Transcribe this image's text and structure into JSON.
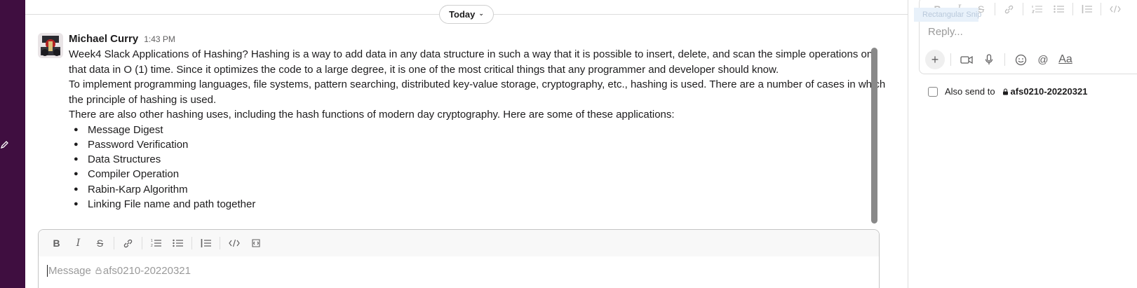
{
  "date_divider": {
    "label": "Today"
  },
  "message": {
    "sender": "Michael Curry",
    "time": "1:43 PM",
    "paragraphs": [
      "Week4 Slack Applications of Hashing? Hashing is a way to add data in any data structure in such a way that it is possible to insert, delete, and scan the simple operations on that data in O (1) time. Since it optimizes the code to a large degree, it is one of the most critical things that any programmer and developer should know.",
      "To implement programming languages, file systems, pattern searching, distributed key-value storage, cryptography, etc., hashing is used. There are a number of cases in which the principle of hashing is used.",
      "There are also other hashing uses, including the hash functions of modern day cryptography. Here are some of these applications:"
    ],
    "bullets": [
      "Message Digest",
      "Password Verification",
      "Data Structures",
      "Compiler Operation",
      "Rabin-Karp Algorithm",
      "Linking File name and path together"
    ]
  },
  "composer": {
    "placeholder_prefix": "Message",
    "channel": "afs0210-20220321",
    "toolbar_icons": [
      "bold-icon",
      "italic-icon",
      "strikethrough-icon",
      "link-icon",
      "ordered-list-icon",
      "bulleted-list-icon",
      "blockquote-icon",
      "code-icon",
      "code-block-icon"
    ]
  },
  "thread": {
    "snip_label": "Rectangular Snip",
    "reply_placeholder": "Reply...",
    "also_send_label": "Also send to",
    "also_send_channel": "afs0210-20220321",
    "action_icons": [
      "plus-icon",
      "video-icon",
      "microphone-icon",
      "emoji-icon",
      "mention-icon",
      "format-icon"
    ]
  },
  "colors": {
    "sidebar": "#3f0e40",
    "text": "#1d1c1d",
    "muted": "#616061",
    "border": "#dddddd"
  }
}
